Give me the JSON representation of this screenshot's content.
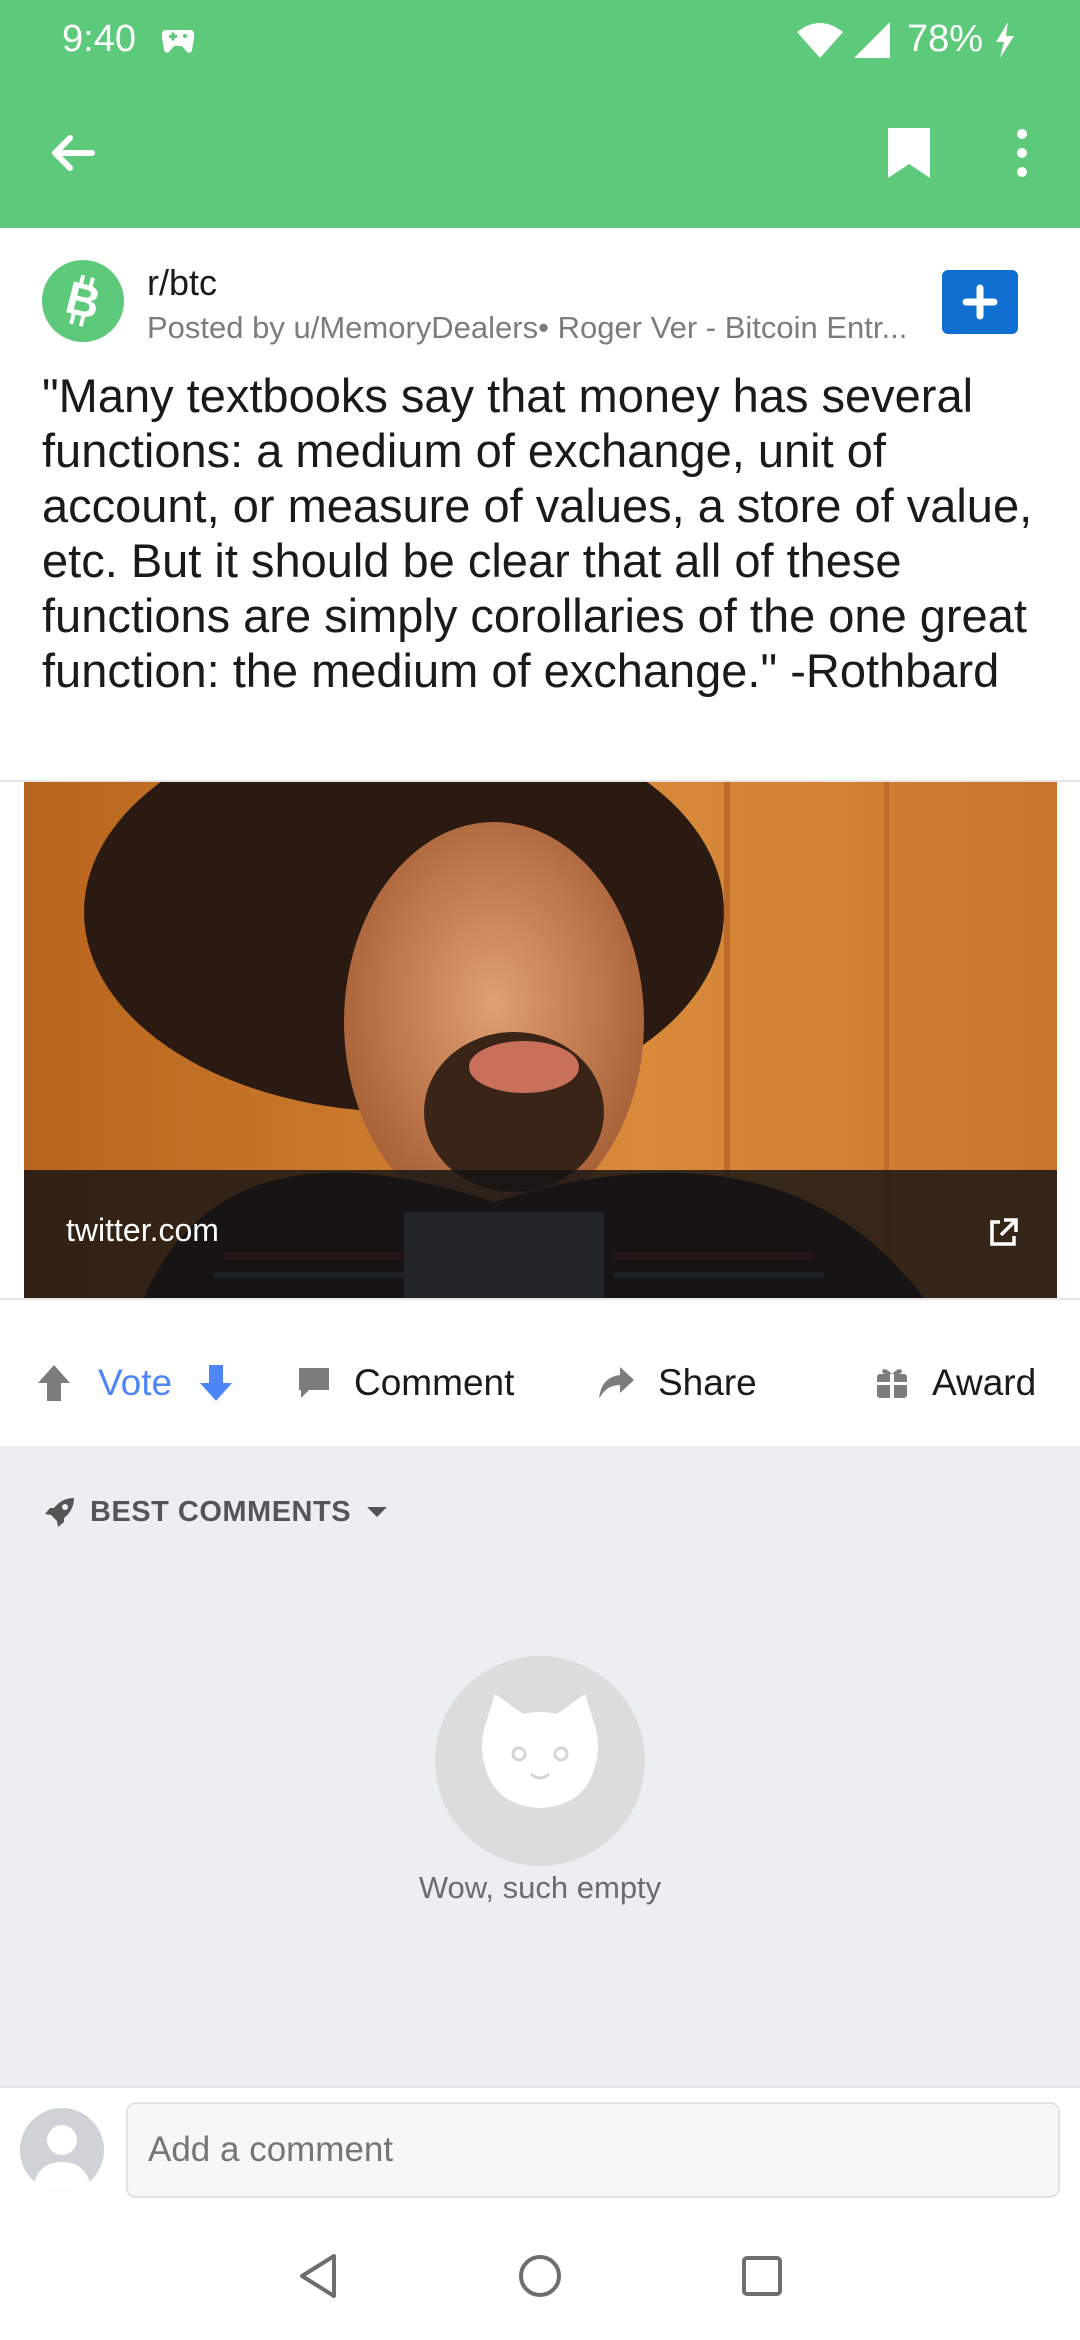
{
  "status_bar": {
    "time": "9:40",
    "battery": "78%",
    "icons": [
      "game-controller-icon",
      "wifi-icon",
      "signal-icon",
      "charging-bolt-icon"
    ]
  },
  "app_bar": {
    "icons": [
      "back-arrow-icon",
      "bookmark-icon",
      "more-vert-icon"
    ],
    "accent_color": "#5dc97a"
  },
  "post": {
    "subreddit": "r/btc",
    "posted_by": "Posted by u/MemoryDealers• Roger Ver - Bitcoin Entr...",
    "title": "\"Many textbooks say that money has several functions: a medium of exchange, unit of account, or measure of values, a store of value, etc. But it should be clear that all of these functions are simply corollaries of the one great function: the medium of exchange.\" -Rothbard",
    "link_domain": "twitter.com",
    "join_button_color": "#0f6fd1"
  },
  "actions": {
    "vote": "Vote",
    "comment": "Comment",
    "share": "Share",
    "award": "Award",
    "vote_color": "#4f86f7"
  },
  "comments": {
    "sort_label": "BEST COMMENTS",
    "empty_text": "Wow, such empty"
  },
  "comment_input": {
    "placeholder": "Add a comment"
  },
  "nav": {
    "icons": [
      "nav-back-icon",
      "nav-home-icon",
      "nav-recents-icon"
    ]
  }
}
